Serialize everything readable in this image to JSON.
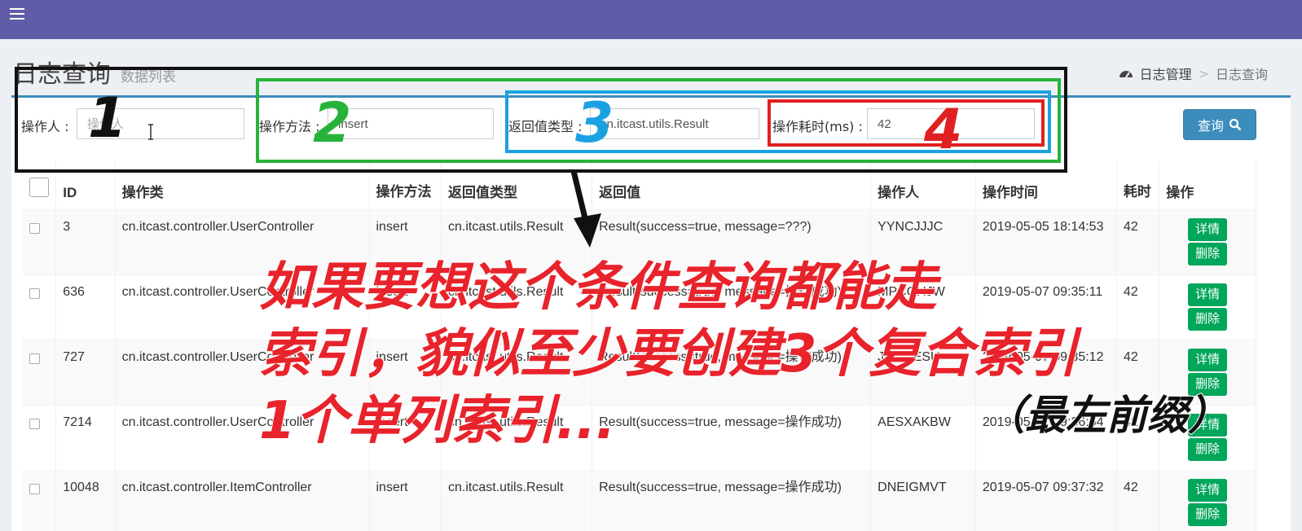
{
  "header": {
    "title": "日志查询",
    "subtitle": "数据列表"
  },
  "breadcrumb": {
    "root": "日志管理",
    "separator": ">",
    "current": "日志查询"
  },
  "search": {
    "operator_label": "操作人 :",
    "operator_placeholder": "操作人",
    "method_label": "操作方法 :",
    "method_value": "insert",
    "return_type_label": "返回值类型 :",
    "return_type_value": "cn.itcast.utils.Result",
    "cost_label": "操作耗时(ms) :",
    "cost_value": "42",
    "query_button": "查询"
  },
  "table": {
    "columns": [
      "ID",
      "操作类",
      "操作方法",
      "返回值类型",
      "返回值",
      "操作人",
      "操作时间",
      "耗时",
      "操作"
    ],
    "rows": [
      {
        "id": "3",
        "cls": "cn.itcast.controller.UserController",
        "method": "insert",
        "rtype": "cn.itcast.utils.Result",
        "rval": "Result(success=true, message=???)",
        "op": "YYNCJJJC",
        "time": "2019-05-05 18:14:53",
        "cost": "42"
      },
      {
        "id": "636",
        "cls": "cn.itcast.controller.UserController",
        "method": "insert",
        "rtype": "cn.itcast.utils.Result",
        "rval": "Result(success=true, message=操作成功)",
        "op": "MPCQHJW",
        "time": "2019-05-07 09:35:11",
        "cost": "42"
      },
      {
        "id": "727",
        "cls": "cn.itcast.controller.UserController",
        "method": "insert",
        "rtype": "cn.itcast.utils.Result",
        "rval": "Result(success=true, message=操作成功)",
        "op": "JQKOESU",
        "time": "2019-05-07 09:35:12",
        "cost": "42"
      },
      {
        "id": "7214",
        "cls": "cn.itcast.controller.UserController",
        "method": "insert",
        "rtype": "cn.itcast.utils.Result",
        "rval": "Result(success=true, message=操作成功)",
        "op": "AESXAKBW",
        "time": "2019-05-07 09:36:54",
        "cost": "42"
      },
      {
        "id": "10048",
        "cls": "cn.itcast.controller.ItemController",
        "method": "insert",
        "rtype": "cn.itcast.utils.Result",
        "rval": "Result(success=true, message=操作成功)",
        "op": "DNEIGMVT",
        "time": "2019-05-07 09:37:32",
        "cost": "42"
      }
    ],
    "detail_button": "详情",
    "delete_button": "删除"
  },
  "annotation": {
    "num1": "1",
    "num2": "2",
    "num3": "3",
    "num4": "4",
    "line1": "如果要想这个条件查询都能走",
    "line2": "索引，貌似至少要创建3个复合索引",
    "line3": "1个单列索引...",
    "paren": "（最左前缀）",
    "colors": {
      "black": "#111111",
      "green": "#27b33a",
      "blue": "#1ba1e2",
      "red": "#e02020"
    }
  },
  "colors": {
    "topbar": "#605ca8",
    "primary": "#3c8dbc",
    "success": "#00a65a"
  }
}
